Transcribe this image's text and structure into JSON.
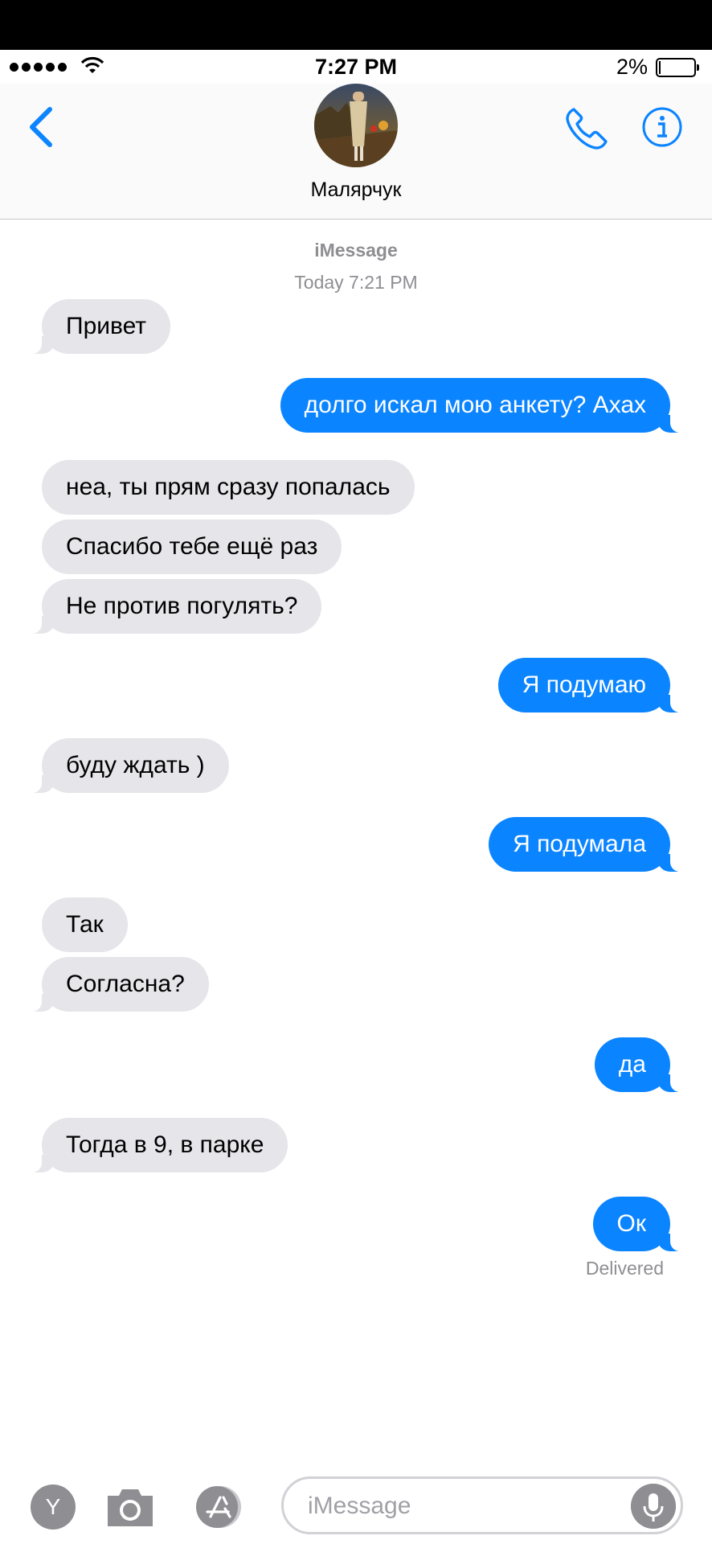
{
  "status_bar": {
    "time": "7:27 PM",
    "battery_percent": "2%",
    "battery_level": 0.02,
    "signal_icon": "signal-dots-icon",
    "wifi_icon": "wifi-icon"
  },
  "header": {
    "contact_name": "Малярчук",
    "back_icon": "chevron-left-icon",
    "phone_icon": "phone-icon",
    "info_icon": "info-icon"
  },
  "conversation": {
    "service": "iMessage",
    "timestamp": "Today 7:21 PM",
    "messages": [
      {
        "direction": "in",
        "text": "Привет"
      },
      {
        "direction": "out",
        "text": "долго искал мою анкету? Ахах"
      },
      {
        "direction": "in",
        "text": "неа, ты прям сразу попалась"
      },
      {
        "direction": "in",
        "text": "Спасибо тебе ещё раз"
      },
      {
        "direction": "in",
        "text": "Не против погулять?"
      },
      {
        "direction": "out",
        "text": "Я подумаю"
      },
      {
        "direction": "in",
        "text": "буду ждать )"
      },
      {
        "direction": "out",
        "text": "Я подумала"
      },
      {
        "direction": "in",
        "text": "Так"
      },
      {
        "direction": "in",
        "text": "Согласна?"
      },
      {
        "direction": "out",
        "text": "да"
      },
      {
        "direction": "in",
        "text": "Тогда в 9, в парке"
      },
      {
        "direction": "out",
        "text": "Ок"
      }
    ],
    "delivery_status": "Delivered"
  },
  "input_bar": {
    "placeholder": "iMessage",
    "app_button_label": "Y",
    "camera_icon": "camera-icon",
    "appstore_icon": "appstore-icon",
    "mic_icon": "microphone-icon"
  },
  "colors": {
    "accent": "#0b84ff",
    "incoming_bubble": "#e5e5ea",
    "meta_text": "#8e8e93"
  }
}
